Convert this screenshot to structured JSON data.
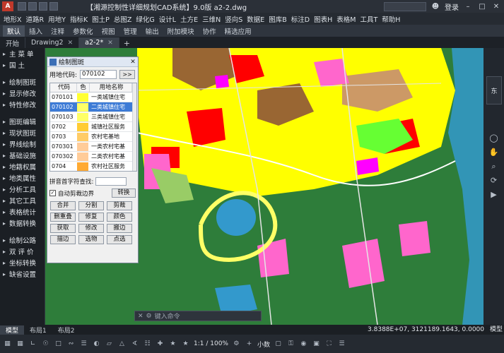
{
  "titlebar": {
    "title": "【湘源控制性详细规划CAD系统】9.0版    a2-2.dwg",
    "search_placeholder": "",
    "login_label": "登录"
  },
  "menubar": {
    "items": [
      "地形X",
      "道路R",
      "用地Y",
      "指标K",
      "图土P",
      "总图Z",
      "绿化G",
      "设计L",
      "土方E",
      "三维N",
      "竖向S",
      "数据E",
      "图库B",
      "标注D",
      "图表H",
      "表格M",
      "工具T",
      "帮助H"
    ]
  },
  "ribbon": {
    "tabs": [
      "默认",
      "插入",
      "注释",
      "参数化",
      "视图",
      "管理",
      "输出",
      "附加模块",
      "协作",
      "精选应用"
    ],
    "active": 0
  },
  "doc_tabs": {
    "tabs": [
      "开始",
      "Drawing2",
      "a2-2*"
    ],
    "active": 2
  },
  "left_panel": {
    "items": [
      "主 菜 单",
      "国    土",
      "",
      "绘制图斑",
      "显示修改",
      "特性修改",
      "",
      "图斑编辑",
      "现状图斑",
      "界线绘制",
      "基础设施",
      "地籍权属",
      "地类属性",
      "分析工具",
      "其它工具",
      "表格统计",
      "数据转换",
      "",
      "绘制公路",
      "双 评 价",
      "坐标转换",
      "缺省设置"
    ]
  },
  "dialog": {
    "title": "绘制图斑",
    "code_label": "用地代码:",
    "code_value": "070102",
    "go_label": ">>",
    "columns": [
      "代码",
      "色",
      "用地名称"
    ],
    "rows": [
      {
        "code": "070101",
        "color": "#ffff33",
        "name": "一类城镇住宅"
      },
      {
        "code": "070102",
        "color": "#ffff66",
        "name": "二类城镇住宅"
      },
      {
        "code": "070103",
        "color": "#ffff66",
        "name": "三类城镇住宅"
      },
      {
        "code": "0702",
        "color": "#ffcc33",
        "name": "城镇社区服务"
      },
      {
        "code": "0703",
        "color": "#ffcc66",
        "name": "农村宅基地"
      },
      {
        "code": "070301",
        "color": "#ffcc99",
        "name": "一类农村宅基"
      },
      {
        "code": "070302",
        "color": "#ffcc99",
        "name": "二类农村宅基"
      },
      {
        "code": "0704",
        "color": "#ffaa33",
        "name": "农村社区服务"
      }
    ],
    "selected_row": 1,
    "pinyin_label": "拼音首字符查找:",
    "clip_label": "自动剪裁边界",
    "clip_checked": true,
    "transform_label": "转换",
    "buttons": [
      "合并",
      "分割",
      "剪裁",
      "删重叠",
      "修复",
      "颜色",
      "获取",
      "修改",
      "搬边",
      "描边",
      "选物",
      "点选"
    ]
  },
  "command_line": {
    "placeholder": "键入命令"
  },
  "layout_tabs": {
    "tabs": [
      "模型",
      "布局1",
      "布局2"
    ],
    "active": 0
  },
  "status": {
    "coords": "3.8388E+07, 3121189.1643, 0.0000",
    "model_label": "模型",
    "scale": "1:1 / 100%",
    "font_size": "小数"
  },
  "navbar": {
    "viewcube_label": "东"
  },
  "map_colors": {
    "green": "#2e7d3a",
    "yellow": "#ffff00",
    "red": "#ff0000",
    "pink": "#ff66cc",
    "magenta": "#ff00ff",
    "brown": "#996633",
    "blue": "#3399cc",
    "lime": "#66ff33",
    "lightgreen": "#99cc66",
    "tan": "#cc9966"
  }
}
